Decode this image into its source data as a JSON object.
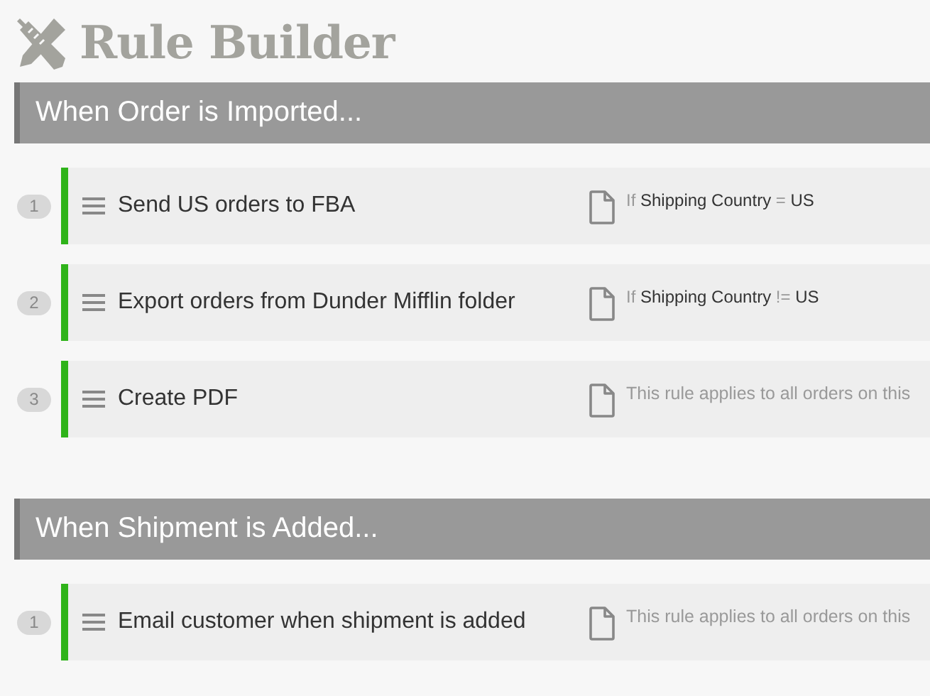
{
  "page": {
    "title": "Rule Builder"
  },
  "sections": [
    {
      "heading": "When Order is Imported...",
      "rules": [
        {
          "number": "1",
          "name": "Send US orders to FBA",
          "enabled": true,
          "summary": {
            "kind": "condition",
            "prefix": "If",
            "field": "Shipping Country",
            "operator": "=",
            "value": "US"
          }
        },
        {
          "number": "2",
          "name": "Export orders from Dunder Mifflin folder",
          "enabled": true,
          "summary": {
            "kind": "condition",
            "prefix": "If",
            "field": "Shipping Country",
            "operator": "!=",
            "value": "US"
          }
        },
        {
          "number": "3",
          "name": "Create PDF",
          "enabled": true,
          "summary": {
            "kind": "all",
            "text": "This rule applies to all orders on this"
          }
        }
      ]
    },
    {
      "heading": "When Shipment is Added...",
      "rules": [
        {
          "number": "1",
          "name": "Email customer when shipment is added",
          "enabled": true,
          "summary": {
            "kind": "all",
            "text": "This rule applies to all orders on this"
          }
        }
      ]
    }
  ]
}
